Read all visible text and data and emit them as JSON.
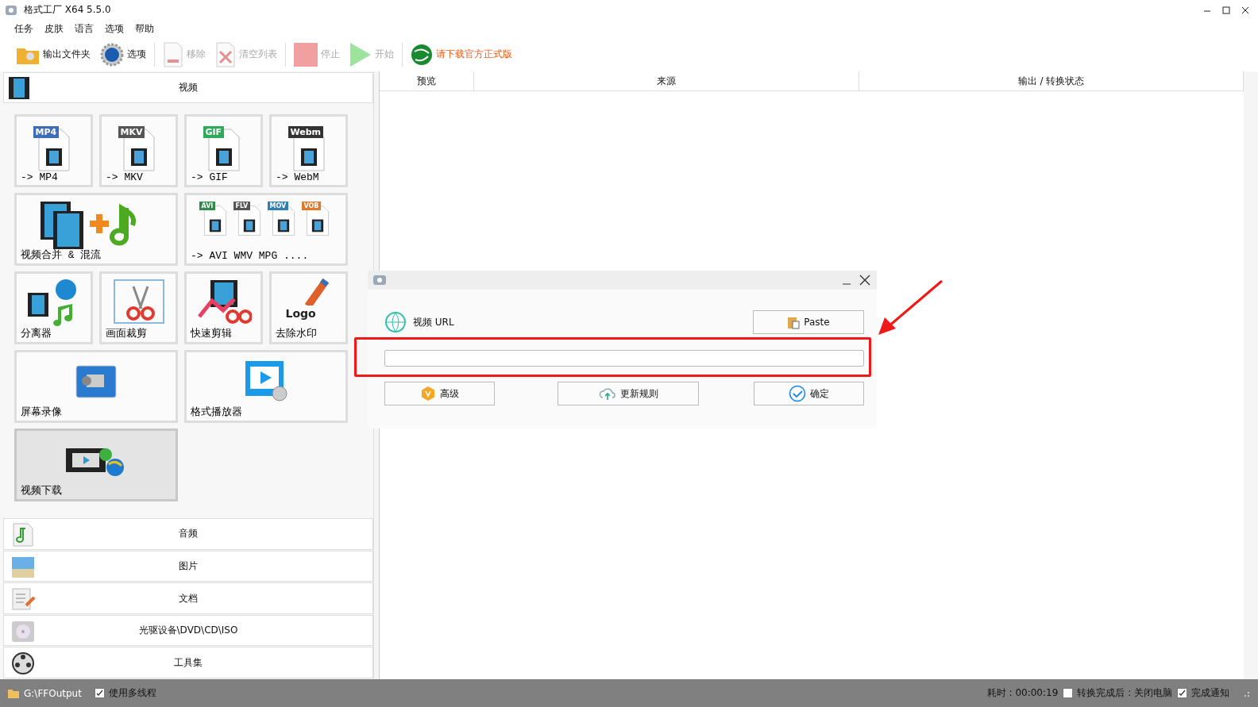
{
  "window": {
    "title": "格式工厂 X64 5.5.0"
  },
  "menu": [
    "任务",
    "皮肤",
    "语言",
    "选项",
    "帮助"
  ],
  "toolbar": [
    {
      "label": "输出文件夹",
      "kind": "button",
      "disabled": false
    },
    {
      "label": "选项",
      "kind": "button",
      "disabled": false
    },
    {
      "label": "移除",
      "kind": "button",
      "disabled": true
    },
    {
      "label": "清空列表",
      "kind": "button",
      "disabled": true
    },
    {
      "label": "停止",
      "kind": "button",
      "disabled": true
    },
    {
      "label": "开始",
      "kind": "button",
      "disabled": true
    },
    {
      "label": "请下载官方正式版",
      "kind": "notice"
    }
  ],
  "sidebar": {
    "open_section": "视频",
    "tiles": [
      {
        "label": "-> MP4",
        "wide": false,
        "selected": false,
        "tags": [
          {
            "text": "MP4",
            "color": "#3d6cb8"
          }
        ]
      },
      {
        "label": "-> MKV",
        "wide": false,
        "selected": false,
        "tags": [
          {
            "text": "MKV",
            "color": "#555555"
          }
        ]
      },
      {
        "label": "-> GIF",
        "wide": false,
        "selected": false,
        "tags": [
          {
            "text": "GIF",
            "color": "#2faa5a"
          }
        ]
      },
      {
        "label": "-> WebM",
        "wide": false,
        "selected": false,
        "tags": [
          {
            "text": "Webm",
            "color": "#333333"
          }
        ]
      },
      {
        "label": "视频合并 & 混流",
        "wide": true,
        "selected": false
      },
      {
        "label": "-> AVI WMV MPG ....",
        "wide": true,
        "selected": false,
        "tags": [
          {
            "text": "AVI",
            "color": "#2e8b4a"
          },
          {
            "text": "FLV",
            "color": "#555555"
          },
          {
            "text": "MOV",
            "color": "#2f7fb0"
          },
          {
            "text": "VOB",
            "color": "#e07a2a"
          }
        ]
      },
      {
        "label": "分离器",
        "wide": false,
        "selected": false
      },
      {
        "label": "画面裁剪",
        "wide": false,
        "selected": false
      },
      {
        "label": "快速剪辑",
        "wide": false,
        "selected": false
      },
      {
        "label": "去除水印",
        "wide": false,
        "selected": false,
        "icon_text": "Logo"
      },
      {
        "label": "屏幕录像",
        "wide": true,
        "selected": false
      },
      {
        "label": "格式播放器",
        "wide": true,
        "selected": false
      },
      {
        "label": "视频下载",
        "wide": true,
        "selected": true
      }
    ],
    "sections": [
      "音频",
      "图片",
      "文档",
      "光驱设备\\DVD\\CD\\ISO",
      "工具集"
    ]
  },
  "table": {
    "columns": [
      "预览",
      "来源",
      "输出 / 转换状态"
    ]
  },
  "dialog": {
    "label": "视频 URL",
    "paste_button": "Paste",
    "buttons": [
      "高级",
      "更新规则",
      "确定"
    ]
  },
  "status_bar": {
    "output_path": "G:\\FFOutput",
    "options": [
      {
        "label": "使用多线程",
        "checked": true
      }
    ],
    "elapsed": "耗时 : 00:00:19",
    "right_options": [
      {
        "label": "转换完成后 : 关闭电脑",
        "checked": false
      },
      {
        "label": "完成通知",
        "checked": true
      }
    ]
  }
}
